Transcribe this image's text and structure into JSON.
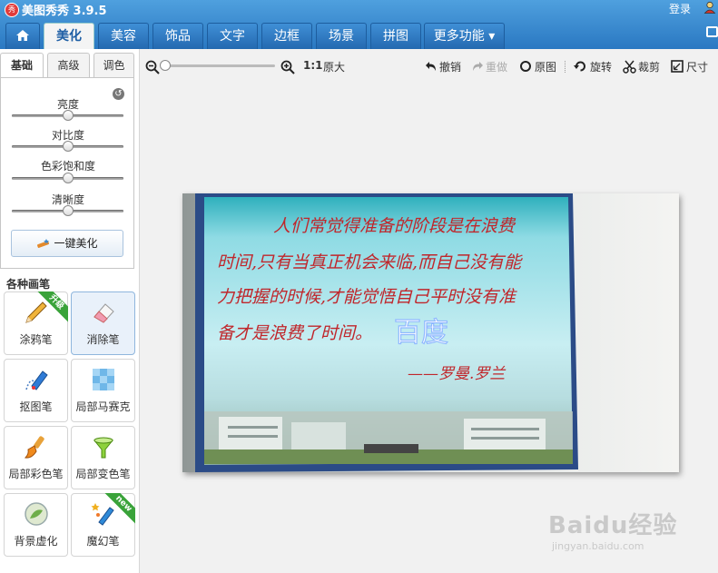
{
  "app": {
    "title": "美图秀秀 3.9.5",
    "logo_text": "秀",
    "login": "登录"
  },
  "tabs": [
    "美化",
    "美容",
    "饰品",
    "文字",
    "边框",
    "场景",
    "拼图",
    "更多功能 ▾"
  ],
  "subtabs": [
    "基础",
    "高级",
    "调色"
  ],
  "sliders": [
    {
      "label": "亮度",
      "value": 0.5
    },
    {
      "label": "对比度",
      "value": 0.5
    },
    {
      "label": "色彩饱和度",
      "value": 0.5
    },
    {
      "label": "清晰度",
      "value": 0.5
    }
  ],
  "auto_beautify": "一键美化",
  "brush_header": "各种画笔",
  "tools": [
    {
      "label": "涂鸦笔",
      "badge": "升级",
      "badge_color": "#3aa33a",
      "icon": "pencil-icon"
    },
    {
      "label": "消除笔",
      "badge": "",
      "icon": "eraser-icon"
    },
    {
      "label": "抠图笔",
      "badge": "",
      "icon": "cutout-pen-icon"
    },
    {
      "label": "局部马赛克",
      "badge": "",
      "icon": "mosaic-icon"
    },
    {
      "label": "局部彩色笔",
      "badge": "",
      "icon": "color-brush-icon"
    },
    {
      "label": "局部变色笔",
      "badge": "",
      "icon": "color-change-icon"
    },
    {
      "label": "背景虚化",
      "badge": "",
      "icon": "background-blur-icon"
    },
    {
      "label": "魔幻笔",
      "badge": "new",
      "badge_color": "#3aa33a",
      "icon": "magic-pen-icon"
    }
  ],
  "toolbar": {
    "zoom_level": 0.0,
    "ratio": "1:1",
    "original_size": "原大",
    "undo": "撤销",
    "redo": "重做",
    "original": "原图",
    "rotate": "旋转",
    "crop": "裁剪",
    "size": "尺寸"
  },
  "photo": {
    "lines": [
      "人们常觉得准备的阶段是在浪费",
      "时间,只有当真正机会来临,而自己没有能",
      "力把握的时候,才能觉悟自己平时没有准",
      "备才是浪费了时间。"
    ],
    "overlay": "百度",
    "author": "——罗曼.罗兰"
  },
  "watermark": {
    "brand": "Baidu经验",
    "url": "jingyan.baidu.com"
  },
  "colors": {
    "topbar": "#2a78c2",
    "accent": "#1f5fa5",
    "poem_red": "#c0262b"
  }
}
